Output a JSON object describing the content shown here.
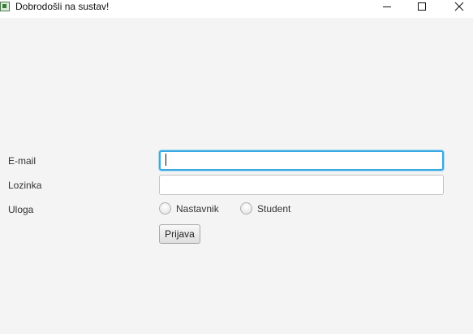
{
  "window": {
    "title": "Dobrodošli na sustav!",
    "controls": [
      "minimize-icon",
      "maximize-icon",
      "close-icon"
    ]
  },
  "form": {
    "email": {
      "label": "E-mail",
      "value": "",
      "placeholder": ""
    },
    "password": {
      "label": "Lozinka",
      "value": "",
      "placeholder": ""
    },
    "role": {
      "label": "Uloga",
      "options": [
        {
          "label": "Nastavnik",
          "selected": false
        },
        {
          "label": "Student",
          "selected": false
        }
      ]
    },
    "submit_label": "Prijava"
  },
  "colors": {
    "background": "#f4f4f4",
    "focus_ring": "#39a9e2",
    "field_border": "#c2c2c2"
  }
}
